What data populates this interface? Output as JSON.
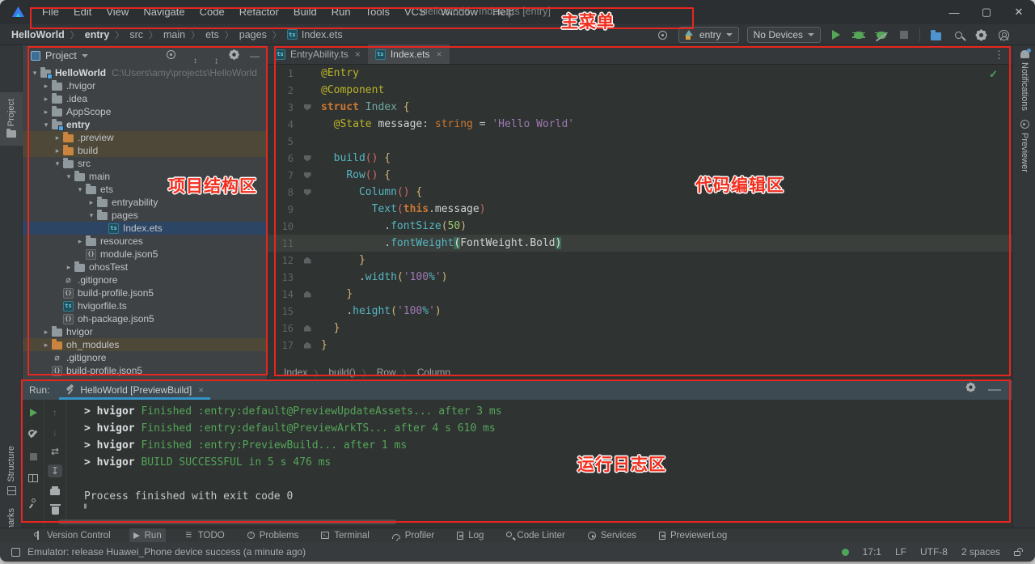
{
  "colors": {
    "accent_blue": "#3592C4",
    "console_green": "#55A55A",
    "selection_blue": "#2D4565",
    "row_highlight_warm": "#4E4839",
    "annotation_red": "#E8251F"
  },
  "annotations": {
    "menu_label": "主菜单",
    "project_label": "项目结构区",
    "editor_label": "代码编辑区",
    "run_label": "运行日志区"
  },
  "titlebar": {
    "title": "HelloWorld - Index.ets [entry]",
    "menus": [
      "File",
      "Edit",
      "View",
      "Navigate",
      "Code",
      "Refactor",
      "Build",
      "Run",
      "Tools",
      "VCS",
      "Window",
      "Help"
    ]
  },
  "toolbar": {
    "breadcrumbs": [
      "HelloWorld",
      "entry",
      "src",
      "main",
      "ets",
      "pages",
      "Index.ets"
    ],
    "module_selector": "entry",
    "device_selector": "No Devices"
  },
  "left_stripe": {
    "project": "Project",
    "structure": "Structure",
    "bookmarks": "Bookmarks"
  },
  "right_stripe": {
    "notifications": "Notifications",
    "previewer": "Previewer"
  },
  "project_panel": {
    "header": "Project",
    "tree": [
      {
        "name": "HelloWorld",
        "level": 0,
        "kind": "module",
        "chev": "exp",
        "bold": true,
        "suffix": "C:\\Users\\amy\\projects\\HelloWorld"
      },
      {
        "name": ".hvigor",
        "level": 1,
        "kind": "folder",
        "chev": "col"
      },
      {
        "name": ".idea",
        "level": 1,
        "kind": "folder",
        "chev": "col"
      },
      {
        "name": "AppScope",
        "level": 1,
        "kind": "folder",
        "chev": "col"
      },
      {
        "name": "entry",
        "level": 1,
        "kind": "module",
        "chev": "exp",
        "bold": true
      },
      {
        "name": ".preview",
        "level": 2,
        "kind": "folder-orange",
        "chev": "col",
        "row": "warm"
      },
      {
        "name": "build",
        "level": 2,
        "kind": "folder-orange",
        "chev": "col",
        "row": "warm"
      },
      {
        "name": "src",
        "level": 2,
        "kind": "folder",
        "chev": "exp"
      },
      {
        "name": "main",
        "level": 3,
        "kind": "folder",
        "chev": "exp"
      },
      {
        "name": "ets",
        "level": 4,
        "kind": "folder",
        "chev": "exp"
      },
      {
        "name": "entryability",
        "level": 5,
        "kind": "folder",
        "chev": "col"
      },
      {
        "name": "pages",
        "level": 5,
        "kind": "folder",
        "chev": "exp"
      },
      {
        "name": "Index.ets",
        "level": 6,
        "kind": "ets",
        "chev": "",
        "row": "sel"
      },
      {
        "name": "resources",
        "level": 4,
        "kind": "folder",
        "chev": "col"
      },
      {
        "name": "module.json5",
        "level": 4,
        "kind": "json",
        "chev": ""
      },
      {
        "name": "ohosTest",
        "level": 3,
        "kind": "folder",
        "chev": "col"
      },
      {
        "name": ".gitignore",
        "level": 2,
        "kind": "git",
        "chev": ""
      },
      {
        "name": "build-profile.json5",
        "level": 2,
        "kind": "json",
        "chev": ""
      },
      {
        "name": "hvigorfile.ts",
        "level": 2,
        "kind": "ets",
        "chev": ""
      },
      {
        "name": "oh-package.json5",
        "level": 2,
        "kind": "json",
        "chev": ""
      },
      {
        "name": "hvigor",
        "level": 1,
        "kind": "folder",
        "chev": "col"
      },
      {
        "name": "oh_modules",
        "level": 1,
        "kind": "folder-orange",
        "chev": "col",
        "row": "warm"
      },
      {
        "name": ".gitignore",
        "level": 1,
        "kind": "git",
        "chev": ""
      },
      {
        "name": "build-profile.json5",
        "level": 1,
        "kind": "json",
        "chev": ""
      }
    ]
  },
  "editor": {
    "tabs": [
      {
        "label": "EntryAbility.ts",
        "active": false
      },
      {
        "label": "Index.ets",
        "active": true
      }
    ],
    "breadcrumb": [
      "Index",
      "build()",
      "Row",
      "Column"
    ],
    "code_lines": [
      {
        "num": 1,
        "fold": "",
        "tokens": [
          [
            "t-ann",
            "@Entry"
          ]
        ]
      },
      {
        "num": 2,
        "fold": "",
        "tokens": [
          [
            "t-ann",
            "@Component"
          ]
        ]
      },
      {
        "num": 3,
        "fold": "open",
        "tokens": [
          [
            "t-kwb",
            "struct "
          ],
          [
            "t-type",
            "Index"
          ],
          [
            "t-pln",
            " "
          ],
          [
            "t-brace",
            "{"
          ]
        ]
      },
      {
        "num": 4,
        "fold": "",
        "tokens": [
          [
            "t-pln",
            "  "
          ],
          [
            "t-ann",
            "@State"
          ],
          [
            "t-pln",
            " message"
          ],
          [
            "t-pun",
            ": "
          ],
          [
            "t-kw",
            "string"
          ],
          [
            "t-pun",
            " = "
          ],
          [
            "t-str",
            "'Hello World'"
          ]
        ]
      },
      {
        "num": 5,
        "fold": "",
        "tokens": []
      },
      {
        "num": 6,
        "fold": "open",
        "tokens": [
          [
            "t-pln",
            "  "
          ],
          [
            "t-fn",
            "build"
          ],
          [
            "t-parA",
            "()"
          ],
          [
            "t-pln",
            " "
          ],
          [
            "t-brace",
            "{"
          ]
        ]
      },
      {
        "num": 7,
        "fold": "open",
        "tokens": [
          [
            "t-pln",
            "    "
          ],
          [
            "t-fn",
            "Row"
          ],
          [
            "t-parA",
            "()"
          ],
          [
            "t-pln",
            " "
          ],
          [
            "t-brace",
            "{"
          ]
        ]
      },
      {
        "num": 8,
        "fold": "open",
        "tokens": [
          [
            "t-pln",
            "      "
          ],
          [
            "t-fn",
            "Column"
          ],
          [
            "t-parA",
            "()"
          ],
          [
            "t-pln",
            " "
          ],
          [
            "t-brace",
            "{"
          ]
        ]
      },
      {
        "num": 9,
        "fold": "",
        "tokens": [
          [
            "t-pln",
            "        "
          ],
          [
            "t-fn",
            "Text"
          ],
          [
            "t-parA",
            "("
          ],
          [
            "t-kwb",
            "this"
          ],
          [
            "t-pun",
            "."
          ],
          [
            "t-pln",
            "message"
          ],
          [
            "t-parA",
            ")"
          ]
        ]
      },
      {
        "num": 10,
        "fold": "",
        "tokens": [
          [
            "t-pln",
            "          "
          ],
          [
            "t-pun",
            "."
          ],
          [
            "t-fn",
            "fontSize"
          ],
          [
            "t-brace",
            "("
          ],
          [
            "t-num",
            "50"
          ],
          [
            "t-brace",
            ")"
          ]
        ]
      },
      {
        "num": 11,
        "fold": "",
        "current": true,
        "tokens": [
          [
            "t-pln",
            "          "
          ],
          [
            "t-pun",
            "."
          ],
          [
            "t-fn",
            "fontWeight"
          ],
          [
            "t-hl",
            "("
          ],
          [
            "t-pln",
            "FontWeight"
          ],
          [
            "t-pun",
            "."
          ],
          [
            "t-pln",
            "Bold"
          ],
          [
            "t-hl",
            ")"
          ]
        ]
      },
      {
        "num": 12,
        "fold": "close",
        "tokens": [
          [
            "t-pln",
            "      "
          ],
          [
            "t-brace",
            "}"
          ]
        ]
      },
      {
        "num": 13,
        "fold": "",
        "tokens": [
          [
            "t-pln",
            "      "
          ],
          [
            "t-pun",
            "."
          ],
          [
            "t-fn",
            "width"
          ],
          [
            "t-brace",
            "("
          ],
          [
            "t-str",
            "'100"
          ],
          [
            "t-pct",
            "%"
          ],
          [
            "t-str",
            "'"
          ],
          [
            "t-brace",
            ")"
          ]
        ]
      },
      {
        "num": 14,
        "fold": "close",
        "tokens": [
          [
            "t-pln",
            "    "
          ],
          [
            "t-brace",
            "}"
          ]
        ]
      },
      {
        "num": 15,
        "fold": "",
        "tokens": [
          [
            "t-pln",
            "    "
          ],
          [
            "t-pun",
            "."
          ],
          [
            "t-fn",
            "height"
          ],
          [
            "t-brace",
            "("
          ],
          [
            "t-str",
            "'100"
          ],
          [
            "t-pct",
            "%"
          ],
          [
            "t-str",
            "'"
          ],
          [
            "t-brace",
            ")"
          ]
        ]
      },
      {
        "num": 16,
        "fold": "close",
        "tokens": [
          [
            "t-pln",
            "  "
          ],
          [
            "t-brace",
            "}"
          ]
        ]
      },
      {
        "num": 17,
        "fold": "close",
        "tokens": [
          [
            "t-brace",
            "}"
          ]
        ]
      }
    ]
  },
  "run_panel": {
    "label": "Run:",
    "tab_title": "HelloWorld [PreviewBuild]",
    "console": [
      {
        "prefix": "> hvigor ",
        "message": "Finished :entry:default@PreviewUpdateAssets... after 3 ms",
        "style": "green"
      },
      {
        "prefix": "> hvigor ",
        "message": "Finished :entry:default@PreviewArkTS... after 4 s 610 ms",
        "style": "green"
      },
      {
        "prefix": "> hvigor ",
        "message": "Finished :entry:PreviewBuild... after 1 ms",
        "style": "green"
      },
      {
        "prefix": "> hvigor ",
        "message": "BUILD SUCCESSFUL in 5 s 476 ms",
        "style": "green"
      },
      {
        "prefix": "",
        "message": "",
        "style": "plain"
      },
      {
        "prefix": "",
        "message": "Process finished with exit code 0",
        "style": "plain"
      }
    ]
  },
  "bottom_bar": {
    "items": [
      {
        "label": "Version Control",
        "icon": "branch-icon",
        "cls": "bi-branch",
        "active": false
      },
      {
        "label": "Run",
        "icon": "play-icon",
        "cls": "bi-play",
        "active": true
      },
      {
        "label": "TODO",
        "icon": "todo-list-icon",
        "cls": "bi-list",
        "active": false
      },
      {
        "label": "Problems",
        "icon": "error-circle-icon",
        "cls": "bi-err",
        "active": false
      },
      {
        "label": "Terminal",
        "icon": "terminal-icon",
        "cls": "bi-term",
        "active": false
      },
      {
        "label": "Profiler",
        "icon": "gauge-icon",
        "cls": "bi-gauge",
        "active": false
      },
      {
        "label": "Log",
        "icon": "log-doc-icon",
        "cls": "bi-doc",
        "active": false
      },
      {
        "label": "Code Linter",
        "icon": "linter-search-icon",
        "cls": "bi-mag",
        "active": false
      },
      {
        "label": "Services",
        "icon": "services-icon",
        "cls": "bi-serv",
        "active": false
      },
      {
        "label": "PreviewerLog",
        "icon": "previewer-log-icon",
        "cls": "bi-doc",
        "active": false
      }
    ]
  },
  "status_bar": {
    "message": "Emulator: release Huawei_Phone device success (a minute ago)",
    "cursor": "17:1",
    "line_ending": "LF",
    "encoding": "UTF-8",
    "indent": "2 spaces"
  }
}
